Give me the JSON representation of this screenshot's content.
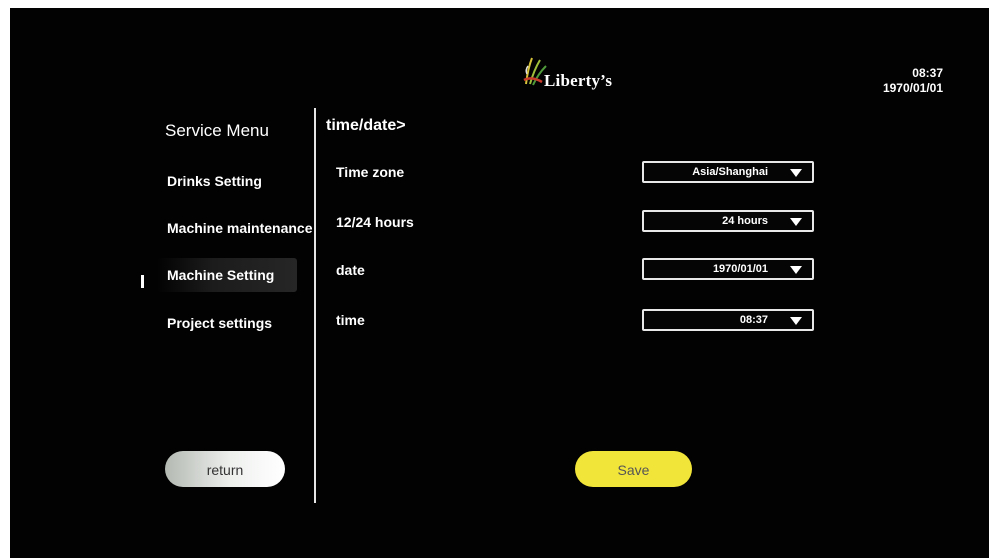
{
  "header": {
    "brand": "Liberty’s",
    "clock_time": "08:37",
    "clock_date": "1970/01/01"
  },
  "sidebar": {
    "title": "Service Menu",
    "items": [
      {
        "label": "Drinks Setting",
        "active": false
      },
      {
        "label": "Machine maintenance",
        "active": false
      },
      {
        "label": "Machine Setting",
        "active": true
      },
      {
        "label": "Project settings",
        "active": false
      }
    ],
    "return_label": "return"
  },
  "main": {
    "breadcrumb": "time/date>",
    "fields": [
      {
        "label": "Time zone",
        "value": "Asia/Shanghai"
      },
      {
        "label": "12/24 hours",
        "value": "24 hours"
      },
      {
        "label": "date",
        "value": "1970/01/01"
      },
      {
        "label": "time",
        "value": "08:37"
      }
    ],
    "save_label": "Save"
  },
  "colors": {
    "background": "#020202",
    "accent_yellow": "#f2e53a",
    "text": "#ffffff"
  }
}
